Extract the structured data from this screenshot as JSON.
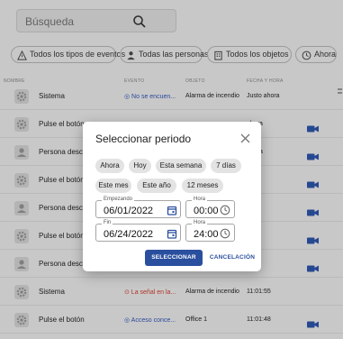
{
  "search": {
    "placeholder": "Búsqueda"
  },
  "filters": [
    {
      "label": "Todos los tipos de eventos",
      "icon": "warning-icon"
    },
    {
      "label": "Todas las personas",
      "icon": "person-icon"
    },
    {
      "label": "Todos los objetos",
      "icon": "building-icon"
    },
    {
      "label": "Ahora",
      "icon": "clock-icon"
    }
  ],
  "table": {
    "headers": {
      "source": "NOMBRE",
      "event": "EVENTO",
      "object": "OBJETO",
      "time": "FECHA Y HORA"
    },
    "rows": [
      {
        "icon": "gear",
        "source": "Sistema",
        "event": "No se encuen...",
        "event_color": "blue",
        "object": "Alarma de incendio",
        "time": "Justo ahora",
        "camera": false
      },
      {
        "icon": "gear",
        "source": "Pulse el botón",
        "event": "",
        "event_color": "blue",
        "object": "",
        "time": "ahora",
        "camera": true
      },
      {
        "icon": "person",
        "source": "Persona desc",
        "event": "",
        "event_color": "blue",
        "object": "",
        "time": "ahora",
        "camera": true
      },
      {
        "icon": "gear",
        "source": "Pulse el botón",
        "event": "",
        "event_color": "blue",
        "object": "",
        "time": ":00",
        "camera": true
      },
      {
        "icon": "person",
        "source": "Persona desc",
        "event": "",
        "event_color": "blue",
        "object": "",
        "time": ":00",
        "camera": true
      },
      {
        "icon": "gear",
        "source": "Pulse el botón",
        "event": "",
        "event_color": "blue",
        "object": "",
        "time": ":56",
        "camera": true
      },
      {
        "icon": "person",
        "source": "Persona desconocido",
        "event": "",
        "event_color": "blue",
        "object": "",
        "time": ":56",
        "camera": true
      },
      {
        "icon": "gear",
        "source": "Sistema",
        "event": "La señal en la...",
        "event_color": "red",
        "object": "Alarma de incendio",
        "time": "11:01:55",
        "camera": false
      },
      {
        "icon": "gear",
        "source": "Pulse el botón",
        "event": "Acceso conce...",
        "event_color": "blue",
        "object": "Office 1",
        "time": "11:01:48",
        "camera": true
      }
    ]
  },
  "dialog": {
    "title": "Seleccionar periodo",
    "presets": [
      "Ahora",
      "Hoy",
      "Esta semana",
      "7 días",
      "Este mes",
      "Este año",
      "12 meses"
    ],
    "start": {
      "date_label": "Empezando",
      "date": "06/01/2022",
      "time_label": "Hora",
      "time": "00:00"
    },
    "end": {
      "date_label": "Fin",
      "date": "06/24/2022",
      "time_label": "Hora",
      "time": "24:00"
    },
    "confirm": "SELECCIONAR",
    "cancel": "CANCELACIÓN"
  },
  "colors": {
    "accent": "#2a4f9e",
    "camera": "#2a4f9e",
    "alert": "#c0392b"
  }
}
